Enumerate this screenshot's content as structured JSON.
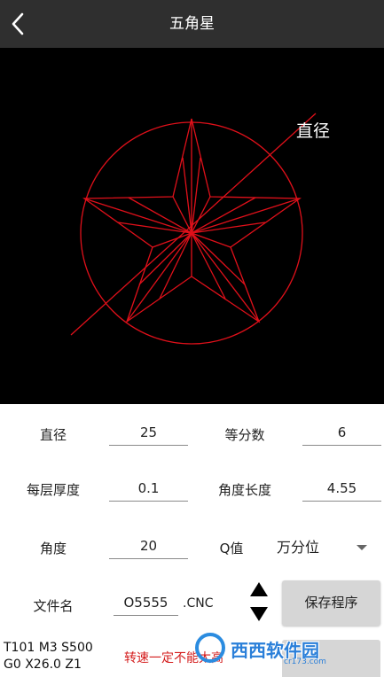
{
  "header": {
    "title": "五角星",
    "back_icon": "chevron-left-icon"
  },
  "canvas": {
    "diameter_label": "直径",
    "line_color": "#e0101a"
  },
  "form": {
    "diameter": {
      "label": "直径",
      "value": "25"
    },
    "divisions": {
      "label": "等分数",
      "value": "6"
    },
    "layer_thickness": {
      "label": "每层厚度",
      "value": "0.1"
    },
    "angle_length": {
      "label": "角度长度",
      "value": "4.55"
    },
    "angle": {
      "label": "角度",
      "value": "20"
    },
    "q_value": {
      "label": "Q值",
      "selected": "万分位"
    },
    "filename": {
      "label": "文件名",
      "value": "O5555",
      "suffix": ".CNC"
    },
    "save_button": "保存程序"
  },
  "footer": {
    "gcode_line1": "T101 M3 S500",
    "gcode_line2": "G0 X26.0 Z1",
    "warning": "转速一定不能太高"
  },
  "watermark": {
    "text": "西西软件园",
    "sub": "cr173.com"
  }
}
